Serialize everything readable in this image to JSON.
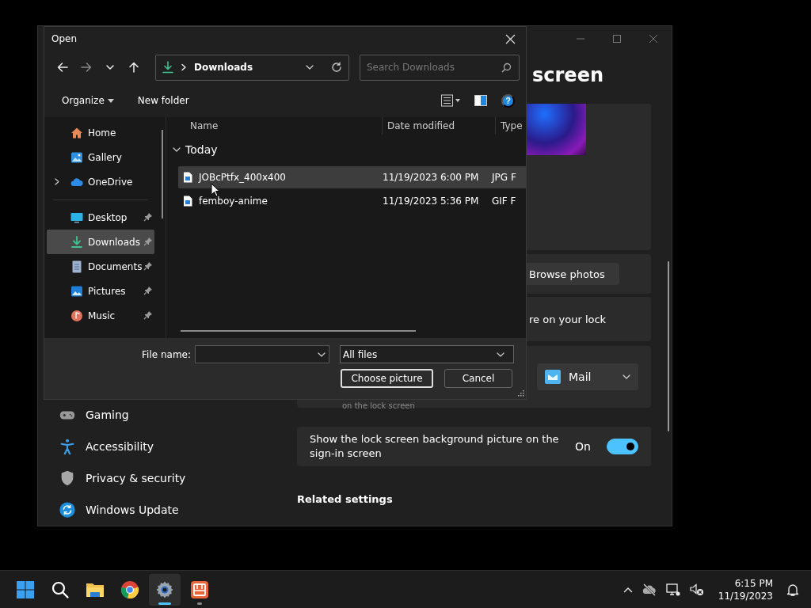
{
  "settings_window": {
    "heading": "screen",
    "browse_button": "Browse photos",
    "partial_text": "re on your lock",
    "app_dropdown": {
      "value": "Mail"
    },
    "caption": "on the lock screen",
    "toggle_setting": {
      "label": "Show the lock screen background picture on the sign-in screen",
      "state_text": "On",
      "on": true
    },
    "section_heading": "Related settings",
    "nav_items": [
      {
        "kind": "gaming",
        "label": "Gaming"
      },
      {
        "kind": "accessibility",
        "label": "Accessibility"
      },
      {
        "kind": "privacy",
        "label": "Privacy & security"
      },
      {
        "kind": "update",
        "label": "Windows Update"
      }
    ]
  },
  "open_dialog": {
    "title": "Open",
    "nav_buttons": [
      {
        "kind": "back",
        "disabled": false
      },
      {
        "kind": "forward",
        "disabled": true
      },
      {
        "kind": "recent",
        "disabled": false
      },
      {
        "kind": "up",
        "disabled": false
      }
    ],
    "address": {
      "folder": "Downloads"
    },
    "search": {
      "placeholder": "Search Downloads"
    },
    "toolbar": {
      "organize": "Organize",
      "new_folder": "New folder",
      "help": "?"
    },
    "quick_nav": [
      {
        "kind": "home",
        "label": "Home",
        "selected": false,
        "expandable": false
      },
      {
        "kind": "gallery",
        "label": "Gallery",
        "selected": false,
        "expandable": false
      },
      {
        "kind": "cloud",
        "label": "OneDrive",
        "selected": false,
        "expandable": true
      }
    ],
    "pinned_nav": [
      {
        "kind": "desktop",
        "label": "Desktop",
        "selected": false,
        "pinned": true
      },
      {
        "kind": "downloads",
        "label": "Downloads",
        "selected": true,
        "pinned": true
      },
      {
        "kind": "documents",
        "label": "Documents",
        "selected": false,
        "pinned": true
      },
      {
        "kind": "pictures",
        "label": "Pictures",
        "selected": false,
        "pinned": true
      },
      {
        "kind": "music",
        "label": "Music",
        "selected": false,
        "pinned": true
      }
    ],
    "columns": [
      "Name",
      "Date modified",
      "Type"
    ],
    "groups": [
      {
        "label": "Today",
        "expanded": true,
        "files": [
          {
            "name": "JOBcPtfx_400x400",
            "date": "11/19/2023 6:00 PM",
            "type": "JPG F",
            "selected": true
          },
          {
            "name": "femboy-anime",
            "date": "11/19/2023 5:36 PM",
            "type": "GIF F",
            "selected": false
          }
        ]
      }
    ],
    "file_name_label": "File name:",
    "filter": "All files",
    "buttons": [
      {
        "label": "Choose picture",
        "default": true
      },
      {
        "label": "Cancel",
        "default": false
      }
    ]
  },
  "taskbar": {
    "apps": [
      {
        "kind": "start",
        "active": false,
        "running": false
      },
      {
        "kind": "search",
        "active": false,
        "running": false
      },
      {
        "kind": "folder",
        "active": false,
        "running": false
      },
      {
        "kind": "browser",
        "active": false,
        "running": false
      },
      {
        "kind": "settings",
        "active": true,
        "running": true
      },
      {
        "kind": "app",
        "active": false,
        "running": true
      }
    ],
    "clock": {
      "time": "6:15 PM",
      "date": "11/19/2023"
    }
  }
}
